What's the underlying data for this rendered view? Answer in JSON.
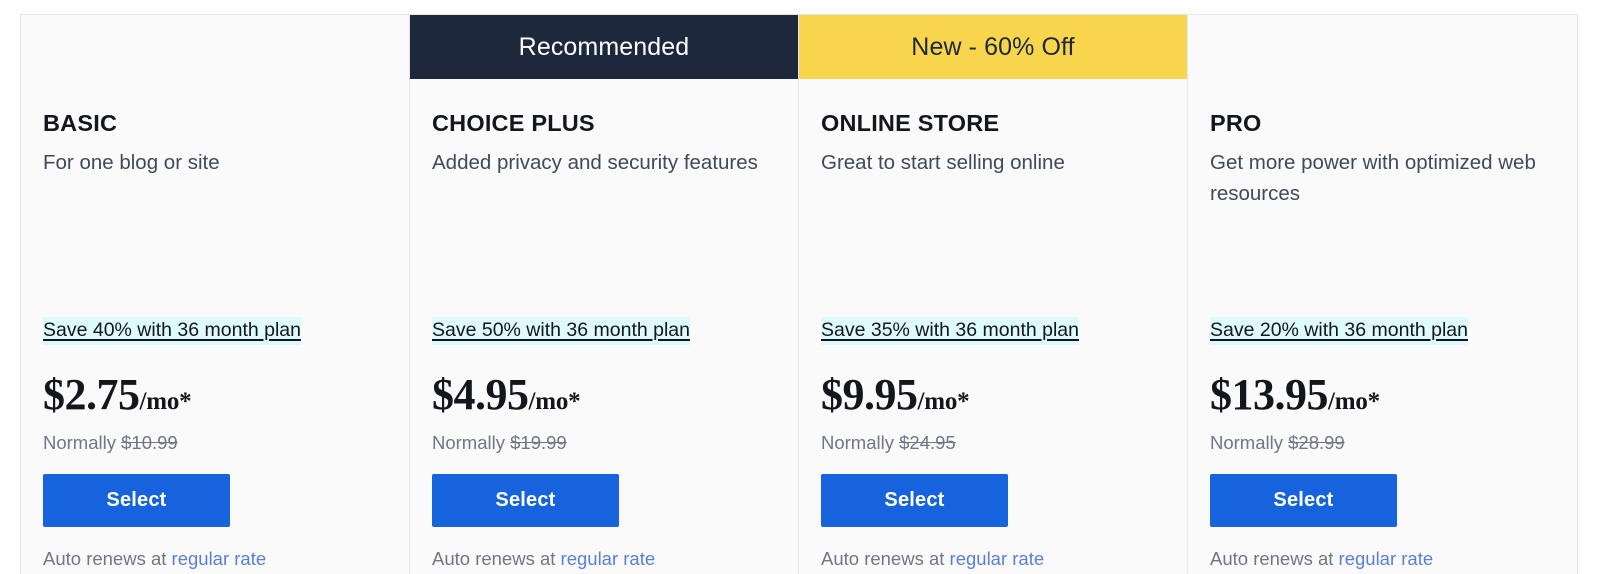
{
  "colors": {
    "page_background": "#ffffff",
    "card_background": "#fafafa",
    "card_border": "#e6e6e8",
    "banner_dark": "#1d283c",
    "banner_gold": "#f9d54e",
    "highlight_cyan": "#defafc",
    "button_blue": "#1763de",
    "link_blue": "#5b7fd4",
    "muted_text": "#6f7785",
    "heading_text": "#13161c"
  },
  "plans": [
    {
      "banner": {
        "label": "",
        "style": "none"
      },
      "name": "BASIC",
      "description": "For one blog or site",
      "save_link": "Save 40% with 36 month plan",
      "price": "$2.75",
      "price_suffix": "/mo*",
      "normally_label": "Normally",
      "normally_price": "$10.99",
      "select_label": "Select",
      "renew_prefix": "Auto renews at",
      "renew_link": "regular rate"
    },
    {
      "banner": {
        "label": "Recommended",
        "style": "dark"
      },
      "name": "CHOICE PLUS",
      "description": "Added privacy and security features",
      "save_link": "Save 50% with 36 month plan",
      "price": "$4.95",
      "price_suffix": "/mo*",
      "normally_label": "Normally",
      "normally_price": "$19.99",
      "select_label": "Select",
      "renew_prefix": "Auto renews at",
      "renew_link": "regular rate"
    },
    {
      "banner": {
        "label": "New - 60% Off",
        "style": "gold"
      },
      "name": "ONLINE STORE",
      "description": "Great to start selling online",
      "save_link": "Save 35% with 36 month plan",
      "price": "$9.95",
      "price_suffix": "/mo*",
      "normally_label": "Normally",
      "normally_price": "$24.95",
      "select_label": "Select",
      "renew_prefix": "Auto renews at",
      "renew_link": "regular rate"
    },
    {
      "banner": {
        "label": "",
        "style": "none"
      },
      "name": "PRO",
      "description": "Get more power with optimized web resources",
      "save_link": "Save 20% with 36 month plan",
      "price": "$13.95",
      "price_suffix": "/mo*",
      "normally_label": "Normally",
      "normally_price": "$28.99",
      "select_label": "Select",
      "renew_prefix": "Auto renews at",
      "renew_link": "regular rate"
    }
  ]
}
